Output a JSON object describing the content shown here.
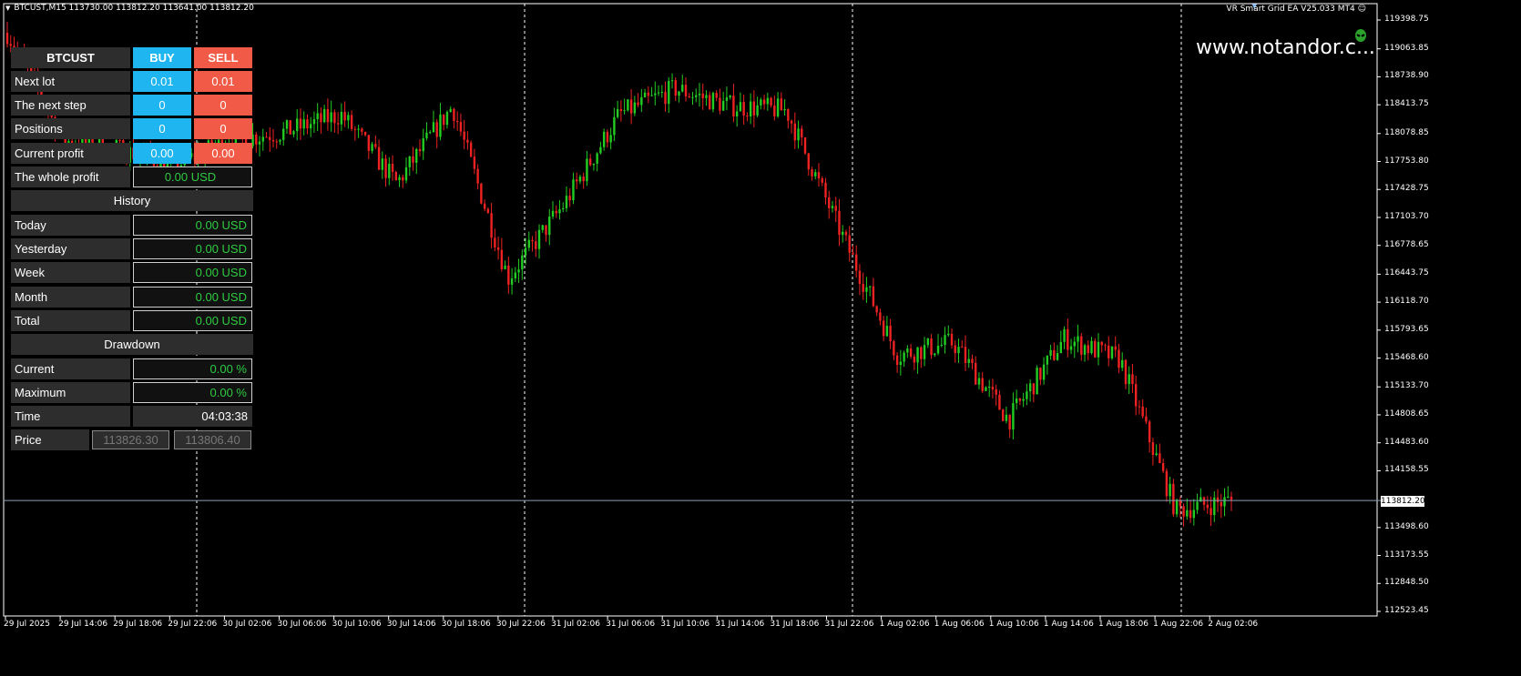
{
  "chart": {
    "header": "BTCUST,M15  113730.00 113812.20 113641.00 113812.20",
    "ea_label": "VR Smart Grid EA  V25.033 MT4",
    "watermark": "www.notandor.c...",
    "current_price": "113812.20",
    "y_labels": [
      "119398.75",
      "119063.85",
      "118738.90",
      "118413.75",
      "118078.85",
      "117753.80",
      "117428.75",
      "117103.70",
      "116778.65",
      "116443.75",
      "116118.70",
      "115793.65",
      "115468.60",
      "115133.70",
      "114808.65",
      "114483.60",
      "114158.55",
      "113498.60",
      "113173.55",
      "112848.50",
      "112523.45"
    ],
    "x_labels": [
      "29 Jul 2025",
      "29 Jul 14:06",
      "29 Jul 18:06",
      "29 Jul 22:06",
      "30 Jul 02:06",
      "30 Jul 06:06",
      "30 Jul 10:06",
      "30 Jul 14:06",
      "30 Jul 18:06",
      "30 Jul 22:06",
      "31 Jul 02:06",
      "31 Jul 06:06",
      "31 Jul 10:06",
      "31 Jul 14:06",
      "31 Jul 18:06",
      "31 Jul 22:06",
      "1 Aug 02:06",
      "1 Aug 06:06",
      "1 Aug 10:06",
      "1 Aug 14:06",
      "1 Aug 18:06",
      "1 Aug 22:06",
      "2 Aug 02:06"
    ],
    "colors": {
      "bull": "#22cc22",
      "bear": "#ee2222",
      "grid": "#ffffff",
      "price_line": "#8aa0b8"
    }
  },
  "chart_data": {
    "type": "line",
    "title": "",
    "xlabel": "",
    "ylabel": "",
    "x": [
      "29 Jul 2025",
      "29 Jul 14:06",
      "29 Jul 18:06",
      "29 Jul 22:06",
      "30 Jul 02:06",
      "30 Jul 06:06",
      "30 Jul 10:06",
      "30 Jul 14:06",
      "30 Jul 18:06",
      "30 Jul 22:06",
      "31 Jul 02:06",
      "31 Jul 06:06",
      "31 Jul 10:06",
      "31 Jul 14:06",
      "31 Jul 18:06",
      "31 Jul 22:06",
      "1 Aug 02:06",
      "1 Aug 06:06",
      "1 Aug 10:06",
      "1 Aug 14:06",
      "1 Aug 18:06",
      "1 Aug 22:06",
      "2 Aug 02:06"
    ],
    "series": [
      {
        "values": [
          119250,
          118000,
          117900,
          117700,
          118000,
          118100,
          118300,
          117500,
          118400,
          116400,
          117250,
          118300,
          118600,
          118400,
          118350,
          116900,
          115500,
          115650,
          114750,
          115700,
          115450,
          113700,
          113812
        ]
      }
    ],
    "ylim": [
      112500,
      119550
    ],
    "grid": false,
    "legend": "none"
  },
  "panel": {
    "symbol": "BTCUST",
    "buy_label": "BUY",
    "sell_label": "SELL",
    "rows": [
      {
        "label": "Next lot",
        "buy": "0.01",
        "sell": "0.01"
      },
      {
        "label": "The next step",
        "buy": "0",
        "sell": "0"
      },
      {
        "label": "Positions",
        "buy": "0",
        "sell": "0"
      },
      {
        "label": "Current profit",
        "buy": "0.00",
        "sell": "0.00"
      }
    ],
    "whole_profit_label": "The whole profit",
    "whole_profit_value": "0.00 USD",
    "history_title": "History",
    "history": [
      {
        "label": "Today",
        "value": "0.00 USD"
      },
      {
        "label": "Yesterday",
        "value": "0.00 USD"
      },
      {
        "label": "Week",
        "value": "0.00 USD"
      },
      {
        "label": "Month",
        "value": "0.00 USD"
      },
      {
        "label": "Total",
        "value": "0.00 USD"
      }
    ],
    "drawdown_title": "Drawdown",
    "drawdown": [
      {
        "label": "Current",
        "value": "0.00 %"
      },
      {
        "label": "Maximum",
        "value": "0.00 %"
      }
    ],
    "time_label": "Time",
    "time_value": "04:03:38",
    "price_label": "Price",
    "price_bid": "113826.30",
    "price_ask": "113806.40"
  }
}
